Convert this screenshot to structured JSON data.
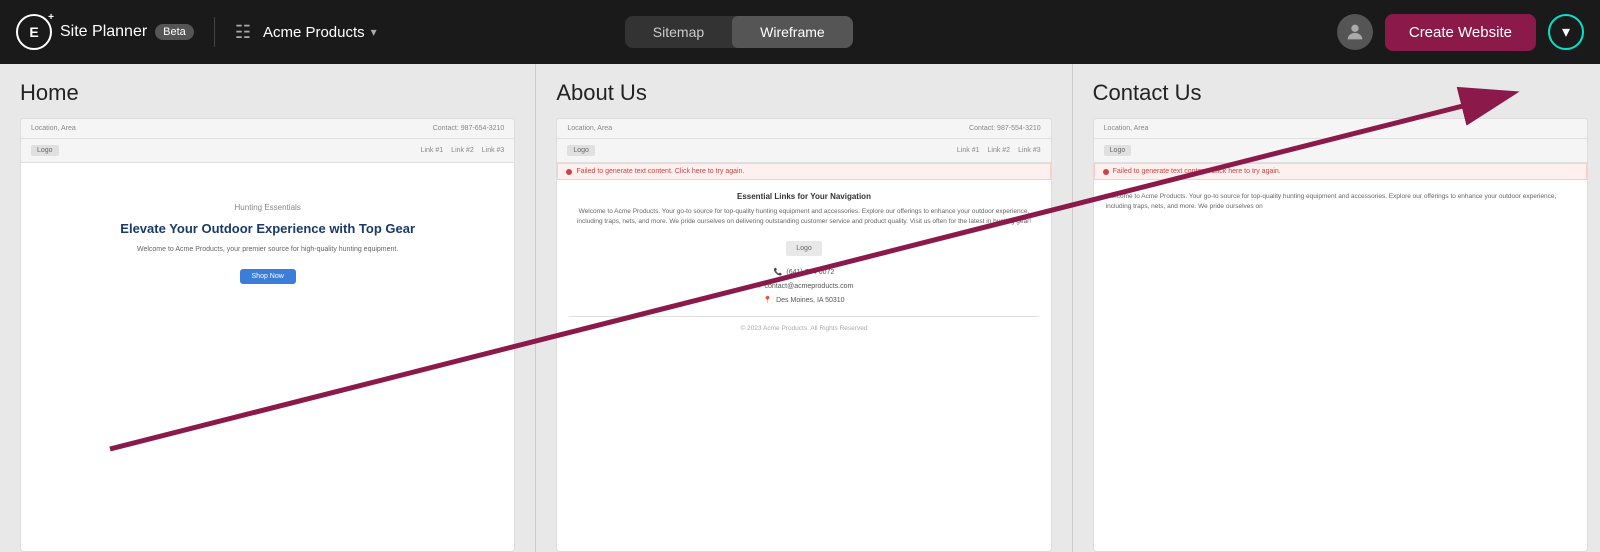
{
  "navbar": {
    "logo_letter": "E",
    "app_name": "Site Planner",
    "beta_label": "Beta",
    "project_name": "Acme Products",
    "tabs": [
      {
        "label": "Sitemap",
        "active": false
      },
      {
        "label": "Wireframe",
        "active": true
      }
    ],
    "create_button": "Create Website",
    "dropdown_icon": "▾"
  },
  "pages": [
    {
      "title": "Home",
      "header_location": "Location, Area",
      "header_contact": "Contact: 987-654-3210",
      "logo_label": "Logo",
      "nav_links": [
        "Link #1",
        "Link #2",
        "Link #3"
      ],
      "category": "Hunting Essentials",
      "headline": "Elevate Your Outdoor Experience with Top Gear",
      "subtext": "Welcome to Acme Products, your premier source for high-quality hunting equipment.",
      "cta": "Shop Now"
    },
    {
      "title": "About Us",
      "header_location": "Location, Area",
      "header_contact": "Contact: 987-554-3210",
      "logo_label": "Logo",
      "nav_links": [
        "Link #1",
        "Link #2",
        "Link #3"
      ],
      "error_text": "Failed to generate text content. Click here to try again.",
      "section_title": "Essential Links for Your Navigation",
      "body_text": "Welcome to Acme Products. Your go-to source for top-quality hunting equipment and accessories. Explore our offerings to enhance your outdoor experience, including traps, nets, and more. We pride ourselves on delivering outstanding customer service and product quality. Visit us often for the latest in hunting gear!",
      "logo_label2": "Logo",
      "phone": "(641) 754-0072",
      "email": "contact@acmeproducts.com",
      "address": "Des Moines, IA 50310",
      "footer": "© 2023 Acme Products. All Rights Reserved"
    },
    {
      "title": "Contact Us",
      "header_location": "Location, Area",
      "logo_label": "Logo",
      "error_text": "Failed to generate text content. Click here to try again.",
      "body_text": "Welcome to Acme Products. Your go-to source for top-quality hunting equipment and accessories. Explore our offerings to enhance your outdoor experience, including traps, nets, and more. We pride ourselves on"
    }
  ],
  "arrow": {
    "color": "#8b1a4a"
  }
}
